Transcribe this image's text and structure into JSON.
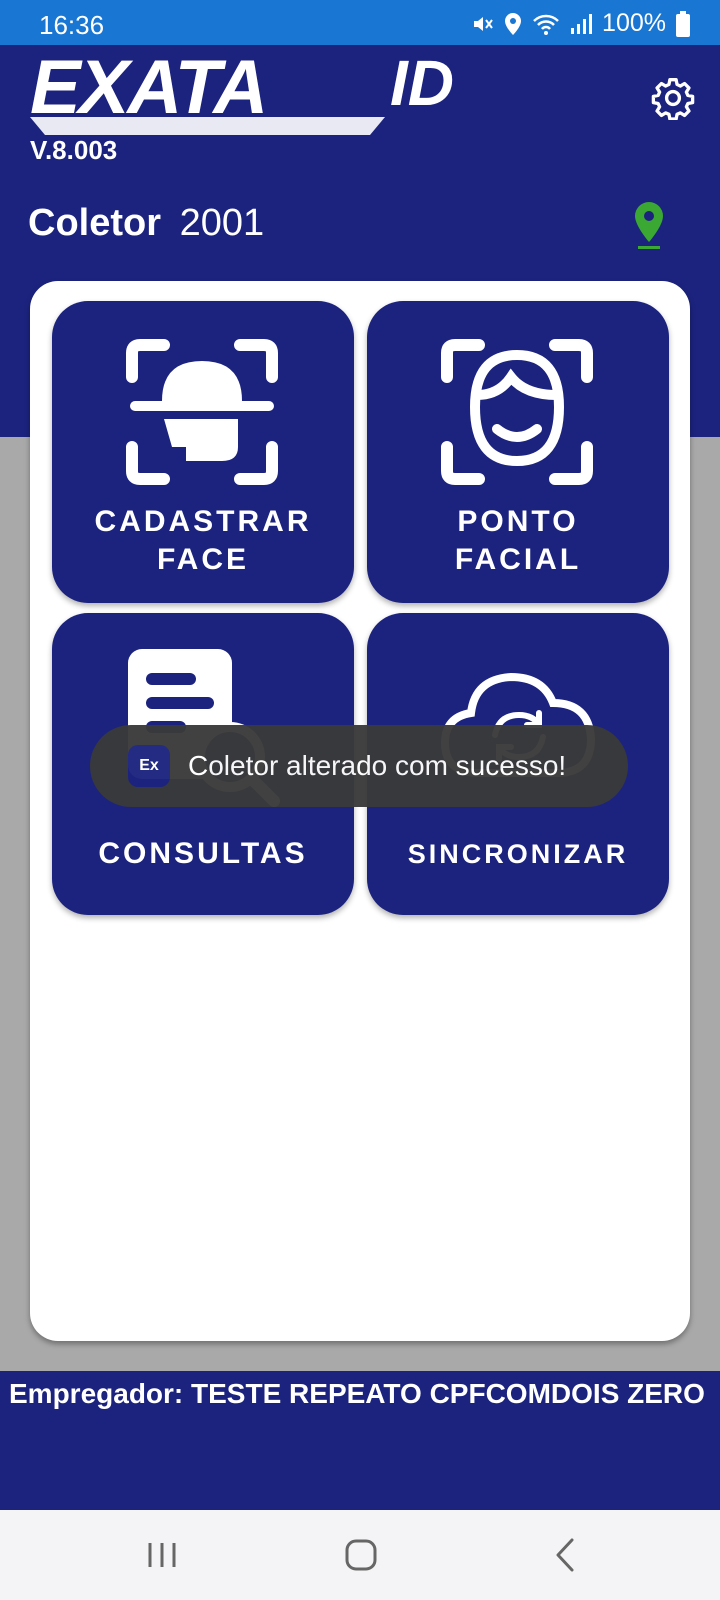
{
  "status_bar": {
    "time": "16:36",
    "battery": "100%",
    "icons": [
      "mute-icon",
      "location-icon",
      "wifi-icon",
      "signal-icon",
      "battery-icon"
    ]
  },
  "header": {
    "logo_text": "EXATA",
    "logo_suffix": "ID",
    "version": "V.8.003",
    "collector_label": "Coletor",
    "collector_value": "2001",
    "settings_icon": "gear-icon",
    "location_icon": "map-pin-icon"
  },
  "tiles": [
    {
      "line1": "CADASTRAR",
      "line2": "FACE",
      "icon": "face-scan-icon"
    },
    {
      "line1": "PONTO",
      "line2": "FACIAL",
      "icon": "face-recognition-icon"
    },
    {
      "line1": "CONSULTAS",
      "icon": "document-search-icon"
    },
    {
      "line1": "SINCRONIZAR",
      "icon": "cloud-sync-icon"
    }
  ],
  "toast": {
    "app_badge": "Ex",
    "message": "Coletor alterado com sucesso!"
  },
  "footer": {
    "employer": "Empregador: TESTE REPEATO CPFCOMDOIS ZERO"
  },
  "nav_bar": {
    "icons": [
      "recent-apps-icon",
      "home-icon",
      "back-icon"
    ]
  },
  "colors": {
    "status_bar": "#1976d2",
    "primary": "#1c237e",
    "pin": "#3aa832",
    "background": "#a9a9a9"
  }
}
